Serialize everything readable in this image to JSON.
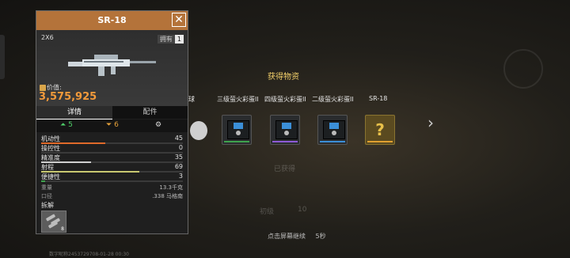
{
  "background": {
    "watermark": "数字昵称2453729708-01-28 00:30"
  },
  "reward": {
    "title": "获得物资",
    "headers": [
      "球",
      "三级萤火彩蛋II",
      "四级萤火彩蛋II",
      "二级萤火彩蛋II",
      "SR-18"
    ],
    "slots": [
      {
        "kind": "white",
        "bar_color": ""
      },
      {
        "kind": "crate",
        "bar_color": "#3fa34d"
      },
      {
        "kind": "crate",
        "bar_color": "#8e5ad6"
      },
      {
        "kind": "crate",
        "bar_color": "#3b8fd8"
      },
      {
        "kind": "gold",
        "bar_color": "#e0a030"
      }
    ],
    "close_hint": "点击屏幕继续",
    "close_seconds": "5秒",
    "ghost_texts": [
      "初级",
      "10",
      "已获得"
    ]
  },
  "panel": {
    "title": "SR-18",
    "close_icon": "close-x-icon",
    "scope": "2X6",
    "owned_label": "拥有",
    "owned_count": "1",
    "price_label": "价值:",
    "price": "3,575,925",
    "tabs": {
      "detail": "详情",
      "parts": "配件"
    },
    "mods": {
      "up": "5",
      "down": "6"
    },
    "stats": [
      {
        "name": "机动性",
        "value": 45,
        "color": "#e06a2a"
      },
      {
        "name": "操控性",
        "value": 0,
        "color": "#777777"
      },
      {
        "name": "精准度",
        "value": 35,
        "color": "#d0d0d0"
      },
      {
        "name": "射程",
        "value": 69,
        "color": "#c8c870"
      },
      {
        "name": "便捷性",
        "value": 3,
        "color": "#3fa34d"
      }
    ],
    "info": [
      {
        "name": "重量",
        "value": "13.3千克"
      },
      {
        "name": "口径",
        "value": ".338 马格南"
      }
    ],
    "disassemble_label": "拆解",
    "part_count": "8"
  }
}
